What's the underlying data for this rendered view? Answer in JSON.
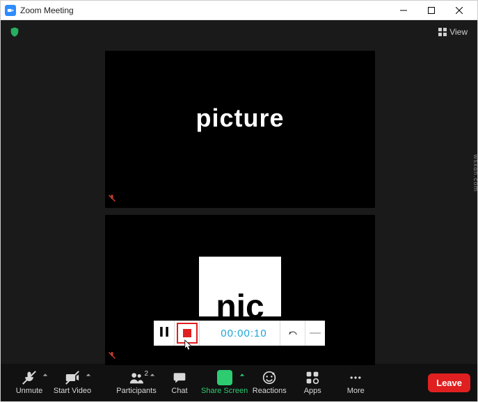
{
  "window": {
    "title": "Zoom Meeting"
  },
  "top": {
    "view_label": "View"
  },
  "tiles": {
    "main_text": "picture",
    "card_text": "nic"
  },
  "recorder": {
    "time": "00:00:10",
    "minimize": "—"
  },
  "controls": {
    "unmute": "Unmute",
    "start_video": "Start Video",
    "participants": "Participants",
    "participants_count": "2",
    "chat": "Chat",
    "share_screen": "Share Screen",
    "reactions": "Reactions",
    "apps": "Apps",
    "more": "More",
    "leave": "Leave"
  },
  "watermark": "wsxdn.com"
}
